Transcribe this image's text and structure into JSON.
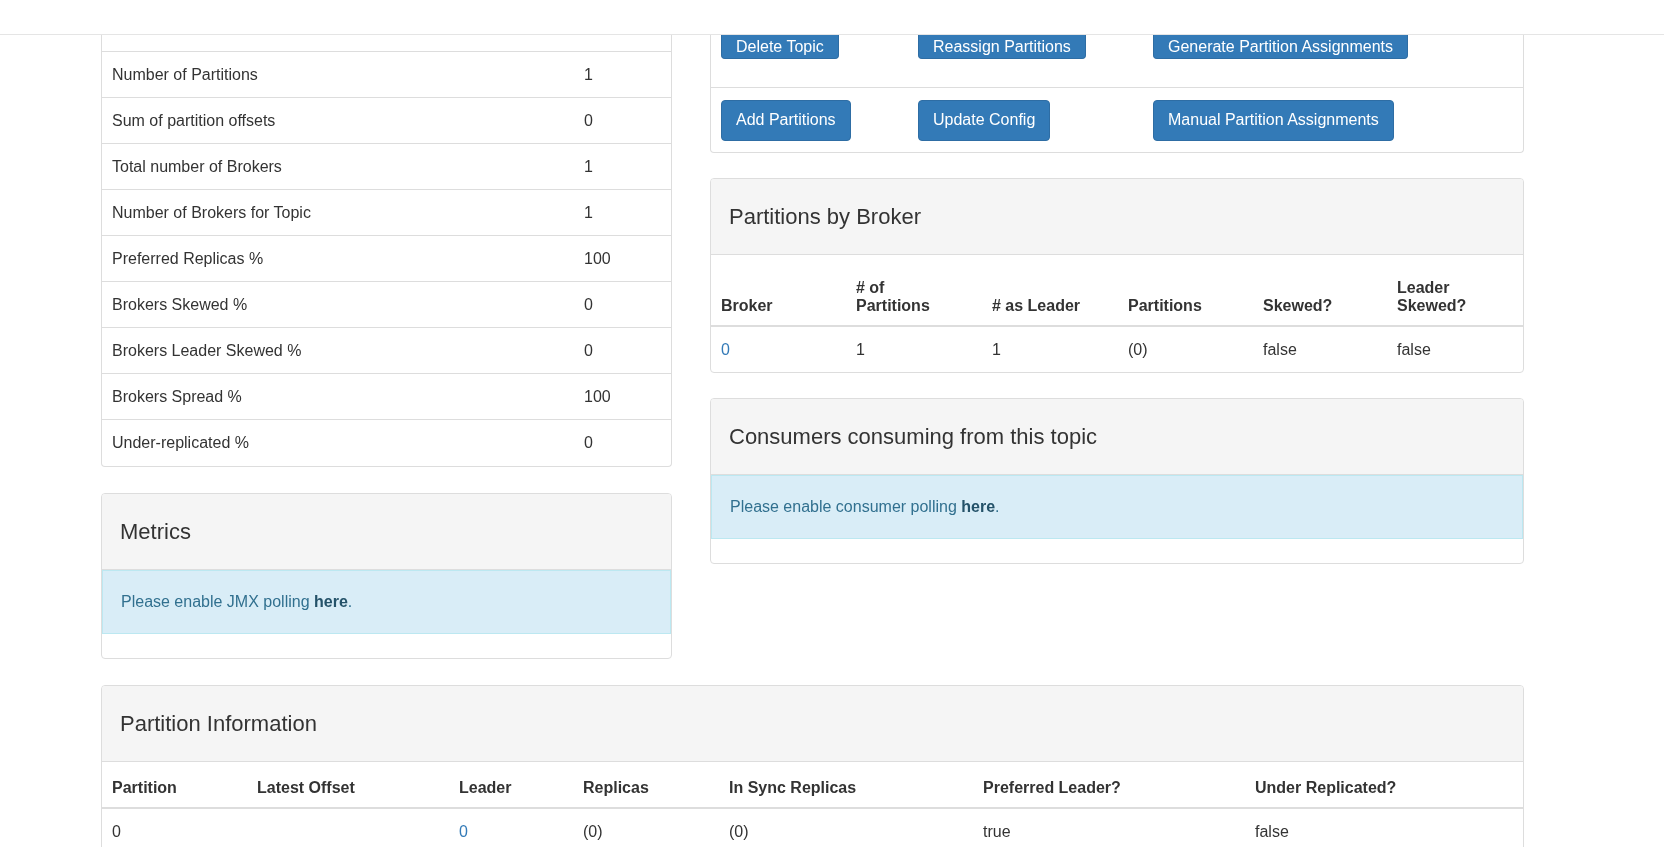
{
  "summary": {
    "rows": [
      {
        "label": "Number of Partitions",
        "value": "1"
      },
      {
        "label": "Sum of partition offsets",
        "value": "0"
      },
      {
        "label": "Total number of Brokers",
        "value": "1"
      },
      {
        "label": "Number of Brokers for Topic",
        "value": "1"
      },
      {
        "label": "Preferred Replicas %",
        "value": "100"
      },
      {
        "label": "Brokers Skewed %",
        "value": "0"
      },
      {
        "label": "Brokers Leader Skewed %",
        "value": "0"
      },
      {
        "label": "Brokers Spread %",
        "value": "100"
      },
      {
        "label": "Under-replicated %",
        "value": "0"
      }
    ]
  },
  "metrics": {
    "title": "Metrics",
    "alert": {
      "text": "Please enable JMX polling ",
      "link": "here",
      "end": "."
    }
  },
  "actions": {
    "rows": [
      {
        "buttons": [
          "Delete Topic",
          "Reassign Partitions",
          "Generate Partition Assignments"
        ]
      },
      {
        "buttons": [
          "Add Partitions",
          "Update Config",
          "Manual Partition Assignments"
        ]
      }
    ]
  },
  "partitions_by_broker": {
    "title": "Partitions by Broker",
    "columns": [
      "Broker",
      "# of Partitions",
      "# as Leader",
      "Partitions",
      "Skewed?",
      "Leader Skewed?"
    ],
    "rows": [
      {
        "cells": [
          {
            "text": "0",
            "kind": "link"
          },
          "1",
          "1",
          "(0)",
          "false",
          "false"
        ]
      }
    ]
  },
  "consumers": {
    "title": "Consumers consuming from this topic",
    "alert": {
      "text": "Please enable consumer polling ",
      "link": "here",
      "end": "."
    }
  },
  "partition_information": {
    "title": "Partition Information",
    "columns": [
      "Partition",
      "Latest Offset",
      "Leader",
      "Replicas",
      "In Sync Replicas",
      "Preferred Leader?",
      "Under Replicated?"
    ],
    "rows": [
      {
        "cells": [
          "0",
          "",
          {
            "text": "0",
            "kind": "link"
          },
          "(0)",
          "(0)",
          "true",
          "false"
        ]
      }
    ]
  }
}
